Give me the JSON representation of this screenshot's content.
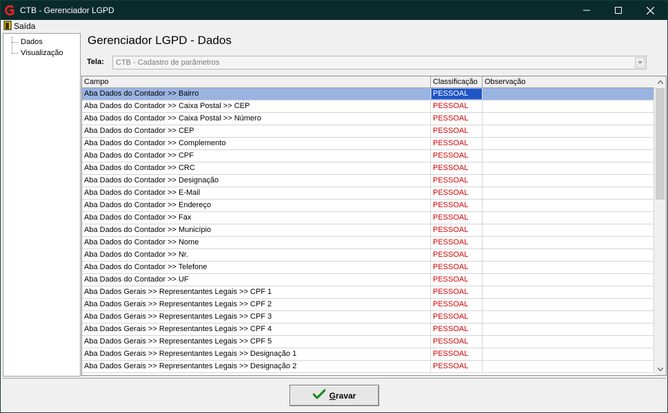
{
  "window": {
    "title": "CTB - Gerenciador LGPD",
    "minimize": "–",
    "maximize": "☐",
    "close": "✕"
  },
  "menu": {
    "items": [
      {
        "label": "Saída",
        "icon": "exit-door-icon"
      }
    ]
  },
  "tree": {
    "items": [
      {
        "label": "Dados"
      },
      {
        "label": "Visualização"
      }
    ]
  },
  "main": {
    "title": "Gerenciador LGPD - Dados",
    "tela_label": "Tela:",
    "tela_value": "CTB - Cadastro de parâmetros"
  },
  "grid": {
    "columns": [
      "Campo",
      "Classificação",
      "Observação"
    ],
    "rows": [
      {
        "campo": "Aba Dados do Contador >> Bairro",
        "classificacao": "PESSOAL",
        "observacao": "",
        "selected": true
      },
      {
        "campo": "Aba Dados do Contador >> Caixa Postal >> CEP",
        "classificacao": "PESSOAL",
        "observacao": ""
      },
      {
        "campo": "Aba Dados do Contador >> Caixa Postal >> Número",
        "classificacao": "PESSOAL",
        "observacao": ""
      },
      {
        "campo": "Aba Dados do Contador >> CEP",
        "classificacao": "PESSOAL",
        "observacao": ""
      },
      {
        "campo": "Aba Dados do Contador >> Complemento",
        "classificacao": "PESSOAL",
        "observacao": ""
      },
      {
        "campo": "Aba Dados do Contador >> CPF",
        "classificacao": "PESSOAL",
        "observacao": ""
      },
      {
        "campo": "Aba Dados do Contador >> CRC",
        "classificacao": "PESSOAL",
        "observacao": ""
      },
      {
        "campo": "Aba Dados do Contador >> Designação",
        "classificacao": "PESSOAL",
        "observacao": ""
      },
      {
        "campo": "Aba Dados do Contador >> E-Mail",
        "classificacao": "PESSOAL",
        "observacao": ""
      },
      {
        "campo": "Aba Dados do Contador >> Endereço",
        "classificacao": "PESSOAL",
        "observacao": ""
      },
      {
        "campo": "Aba Dados do Contador >> Fax",
        "classificacao": "PESSOAL",
        "observacao": ""
      },
      {
        "campo": "Aba Dados do Contador >> Município",
        "classificacao": "PESSOAL",
        "observacao": ""
      },
      {
        "campo": "Aba Dados do Contador >> Nome",
        "classificacao": "PESSOAL",
        "observacao": ""
      },
      {
        "campo": "Aba Dados do Contador >> Nr.",
        "classificacao": "PESSOAL",
        "observacao": ""
      },
      {
        "campo": "Aba Dados do Contador >> Telefone",
        "classificacao": "PESSOAL",
        "observacao": ""
      },
      {
        "campo": "Aba Dados do Contador >> UF",
        "classificacao": "PESSOAL",
        "observacao": ""
      },
      {
        "campo": "Aba Dados Gerais >> Representantes Legais >> CPF 1",
        "classificacao": "PESSOAL",
        "observacao": ""
      },
      {
        "campo": "Aba Dados Gerais >> Representantes Legais >> CPF 2",
        "classificacao": "PESSOAL",
        "observacao": ""
      },
      {
        "campo": "Aba Dados Gerais >> Representantes Legais >> CPF 3",
        "classificacao": "PESSOAL",
        "observacao": ""
      },
      {
        "campo": "Aba Dados Gerais >> Representantes Legais >> CPF 4",
        "classificacao": "PESSOAL",
        "observacao": ""
      },
      {
        "campo": "Aba Dados Gerais >> Representantes Legais >> CPF 5",
        "classificacao": "PESSOAL",
        "observacao": ""
      },
      {
        "campo": "Aba Dados Gerais >> Representantes Legais >> Designação 1",
        "classificacao": "PESSOAL",
        "observacao": ""
      },
      {
        "campo": "Aba Dados Gerais >> Representantes Legais >> Designação 2",
        "classificacao": "PESSOAL",
        "observacao": ""
      }
    ]
  },
  "footer": {
    "save_label_prefix": "G",
    "save_label_rest": "ravar"
  },
  "colors": {
    "titlebar": "#0b2b2b",
    "pessoal": "#d40000",
    "selected": "#99b4e1",
    "selected_cell": "#1e56c8",
    "check": "#1a8a1a"
  }
}
